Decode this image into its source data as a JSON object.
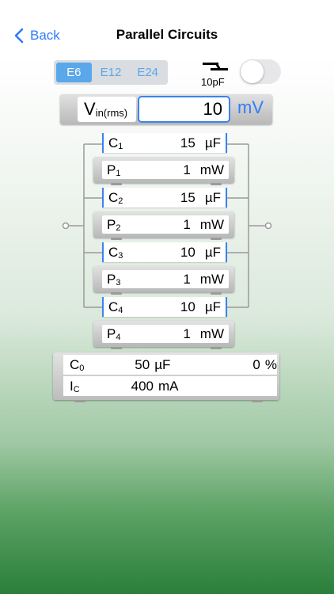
{
  "nav": {
    "back_label": "Back",
    "title": "Parallel Circuits"
  },
  "series_selector": {
    "options": [
      "E6",
      "E12",
      "E24"
    ],
    "selected": "E6"
  },
  "stray_cap": {
    "label": "10pF",
    "enabled": false
  },
  "vin": {
    "label_main": "V",
    "label_sub": "in(rms)",
    "value": "10",
    "unit": "mV"
  },
  "branches": [
    {
      "c_name": "C",
      "c_sub": "1",
      "c_value": "15",
      "c_unit": "µF",
      "p_name": "P",
      "p_sub": "1",
      "p_value": "1",
      "p_unit": "mW"
    },
    {
      "c_name": "C",
      "c_sub": "2",
      "c_value": "15",
      "c_unit": "µF",
      "p_name": "P",
      "p_sub": "2",
      "p_value": "1",
      "p_unit": "mW"
    },
    {
      "c_name": "C",
      "c_sub": "3",
      "c_value": "10",
      "c_unit": "µF",
      "p_name": "P",
      "p_sub": "3",
      "p_value": "1",
      "p_unit": "mW"
    },
    {
      "c_name": "C",
      "c_sub": "4",
      "c_value": "10",
      "c_unit": "µF",
      "p_name": "P",
      "p_sub": "4",
      "p_value": "1",
      "p_unit": "mW"
    }
  ],
  "result": {
    "total_name": "C",
    "total_sub": "0",
    "total_value": "50",
    "total_unit": "µF",
    "tolerance_value": "0",
    "tolerance_unit": "%",
    "current_name": "I",
    "current_sub": "C",
    "current_value": "400",
    "current_unit": "mA"
  },
  "colors": {
    "accent": "#2f7cf6",
    "segment_active": "#5aa7ea",
    "wire": "#9a9a9a"
  }
}
